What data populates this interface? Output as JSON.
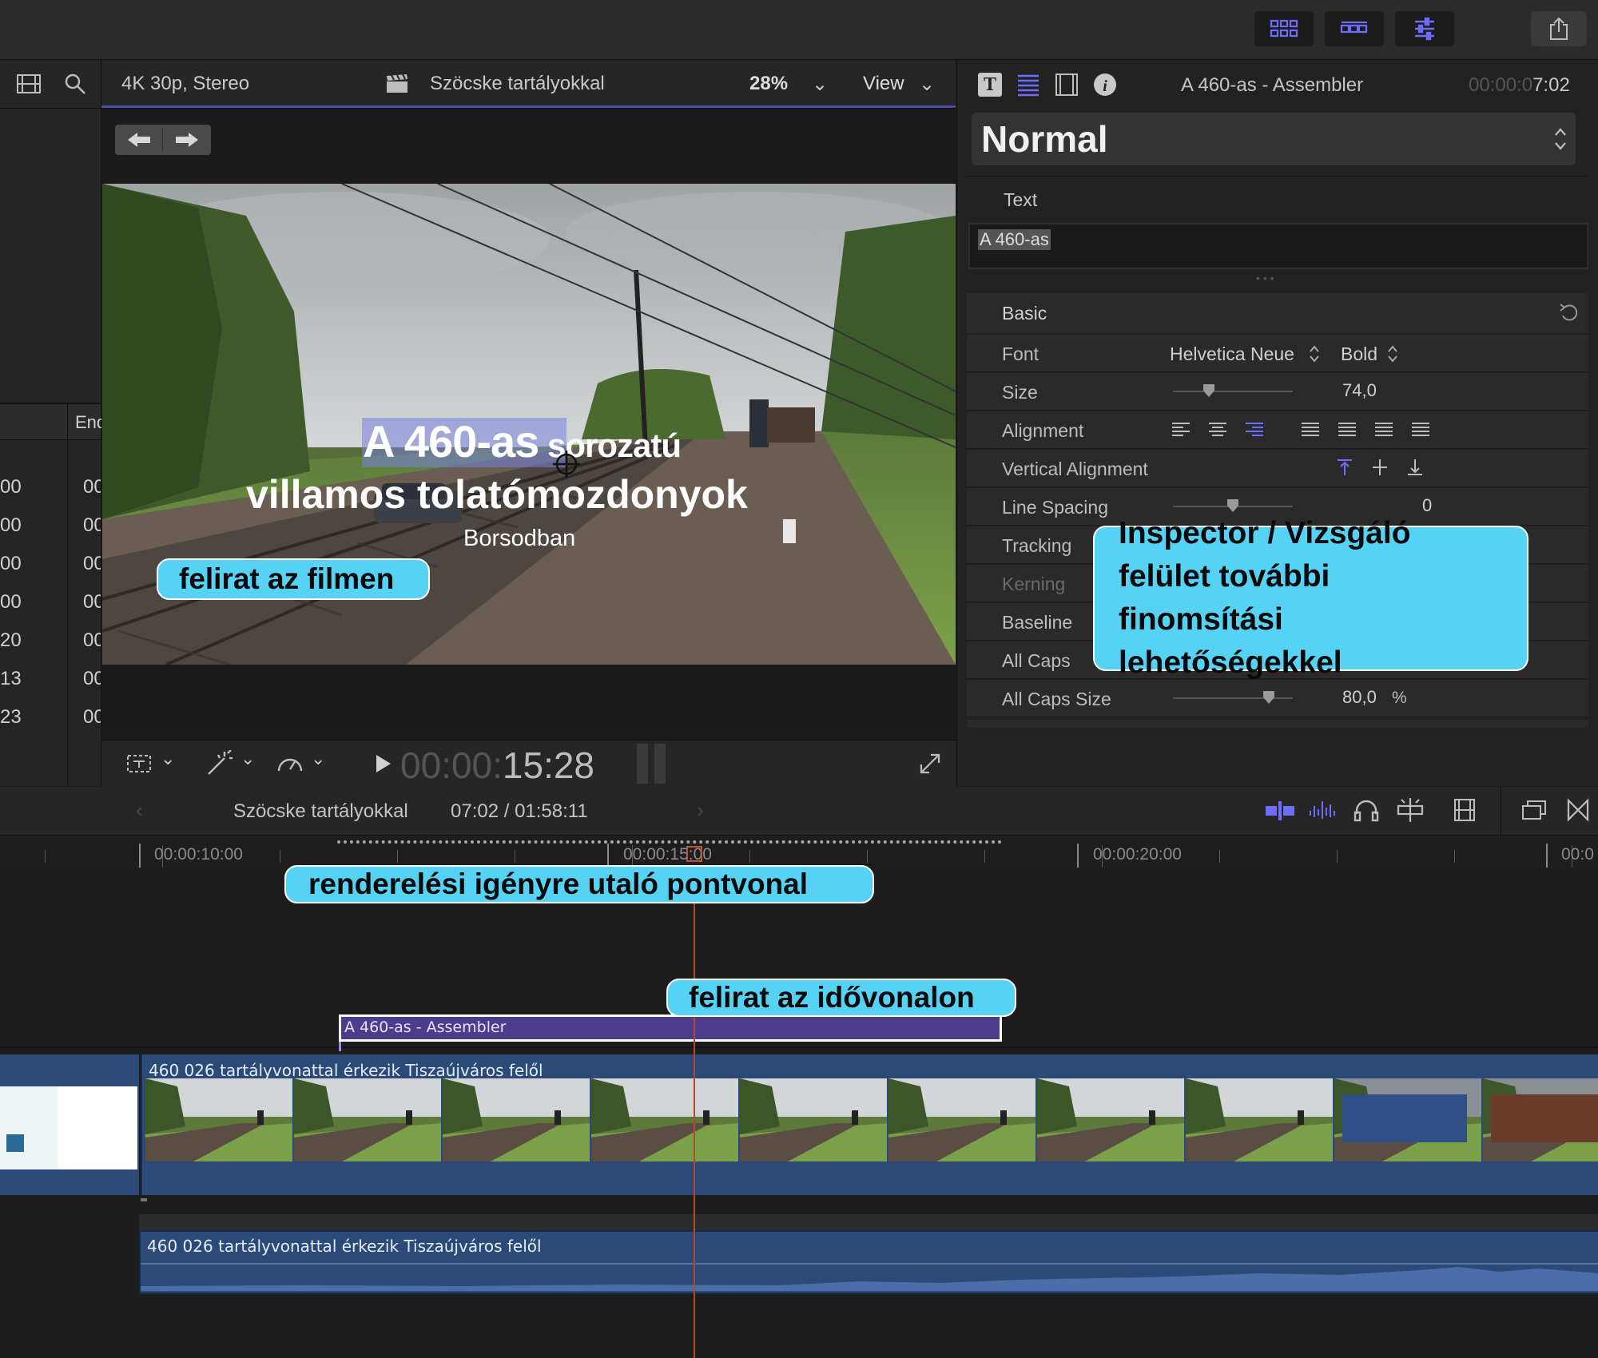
{
  "toolbar": {
    "buttons": [
      "library-toggle-icon",
      "timeline-toggle-icon",
      "inspector-toggle-icon"
    ],
    "share_icon": "share-icon",
    "accent": "#6f6dff"
  },
  "viewer": {
    "format": "4K 30p, Stereo",
    "project": "Szöcske tartályokkal",
    "zoom": "28%",
    "view_label": "View",
    "timecode_dim": "00:00:",
    "timecode": "15:28",
    "title_line1": "A 460-as",
    "title_line1_rest": " sorozatú",
    "title_line2": "villamos tolatómozdonyok",
    "title_line3": "Borsodban"
  },
  "browser": {
    "column_header": "End",
    "rows": [
      {
        "a": "00",
        "b": "00"
      },
      {
        "a": "00",
        "b": "00"
      },
      {
        "a": "00",
        "b": "00"
      },
      {
        "a": "00",
        "b": "00"
      },
      {
        "a": "20",
        "b": "00"
      },
      {
        "a": "13",
        "b": "00"
      },
      {
        "a": "23",
        "b": "00"
      }
    ]
  },
  "inspector": {
    "clip_name": "A 460-as - Assembler",
    "duration_dim": "00:00:0",
    "duration": "7:02",
    "preset": "Normal",
    "text_section": "Text",
    "text_value": "A 460-as",
    "basic_section": "Basic",
    "font_label": "Font",
    "font_family": "Helvetica Neue",
    "font_weight": "Bold",
    "size_label": "Size",
    "size_value": "74,0",
    "size_slider": 0.3,
    "alignment_label": "Alignment",
    "valign_label": "Vertical Alignment",
    "line_spacing_label": "Line Spacing",
    "line_spacing_value": "0",
    "line_spacing_slider": 0.5,
    "tracking_label": "Tracking",
    "kerning_label": "Kerning",
    "baseline_label": "Baseline",
    "allcaps_label": "All Caps",
    "allcaps_size_label": "All Caps Size",
    "allcaps_size_value": "80,0",
    "allcaps_size_unit": "%",
    "allcaps_size_slider": 0.8
  },
  "timeline": {
    "project": "Szöcske tartályokkal",
    "position": "07:02 / 01:58:11",
    "ruler": [
      "00:00:10:00",
      "00:00:15:00",
      "00:00:20:00",
      "00:0"
    ],
    "title_clip": "A 460-as - Assembler",
    "video_clip": "460 026 tartályvonattal érkezik Tiszaújváros felől",
    "audio_clip": "460 026 tartályvonattal érkezik Tiszaújváros felől"
  },
  "callouts": {
    "on_film": "felirat az filmen",
    "inspector_line1": "Inspector / Vizsgáló",
    "inspector_line2": "felület további finomsítási",
    "inspector_line3": "lehetőségekkel",
    "render_dots": "renderelési igényre utaló pontvonal",
    "on_timeline": "felirat az idővonalon"
  }
}
